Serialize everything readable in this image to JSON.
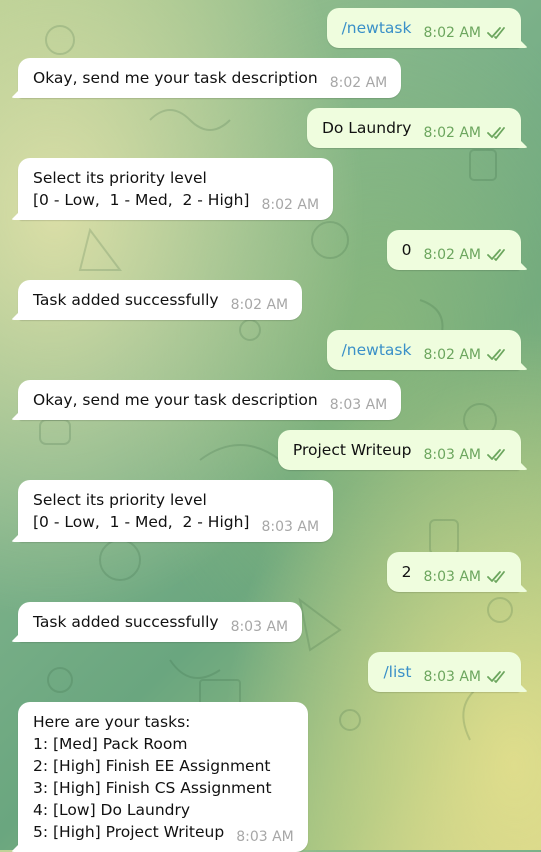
{
  "chat": {
    "messages": [
      {
        "side": "out",
        "text": "/newtask",
        "time": "8:02 AM",
        "read": true,
        "command": true
      },
      {
        "side": "in",
        "text": "Okay, send me your task description",
        "time": "8:02 AM"
      },
      {
        "side": "out",
        "text": "Do Laundry",
        "time": "8:02 AM",
        "read": true
      },
      {
        "side": "in",
        "text": "Select its priority level\n[0 - Low,  1 - Med,  2 - High]",
        "time": "8:02 AM"
      },
      {
        "side": "out",
        "text": "0",
        "time": "8:02 AM",
        "read": true
      },
      {
        "side": "in",
        "text": "Task added successfully",
        "time": "8:02 AM"
      },
      {
        "side": "out",
        "text": "/newtask",
        "time": "8:02 AM",
        "read": true,
        "command": true
      },
      {
        "side": "in",
        "text": "Okay, send me your task description",
        "time": "8:03 AM"
      },
      {
        "side": "out",
        "text": "Project Writeup",
        "time": "8:03 AM",
        "read": true
      },
      {
        "side": "in",
        "text": "Select its priority level\n[0 - Low,  1 - Med,  2 - High]",
        "time": "8:03 AM"
      },
      {
        "side": "out",
        "text": "2",
        "time": "8:03 AM",
        "read": true
      },
      {
        "side": "in",
        "text": "Task added successfully",
        "time": "8:03 AM"
      },
      {
        "side": "out",
        "text": "/list",
        "time": "8:03 AM",
        "read": true,
        "command": true
      },
      {
        "side": "in",
        "text": "Here are your tasks:\n1: [Med] Pack Room\n2: [High] Finish EE Assignment\n3: [High] Finish CS Assignment\n4: [Low] Do Laundry\n5: [High] Project Writeup",
        "time": "8:03 AM"
      }
    ]
  },
  "colors": {
    "outgoing_bubble": "#effdde",
    "incoming_bubble": "#ffffff",
    "command_link": "#3a90c8",
    "read_check": "#6ca65e"
  },
  "icons": {
    "read_receipt": "double-check-icon"
  }
}
